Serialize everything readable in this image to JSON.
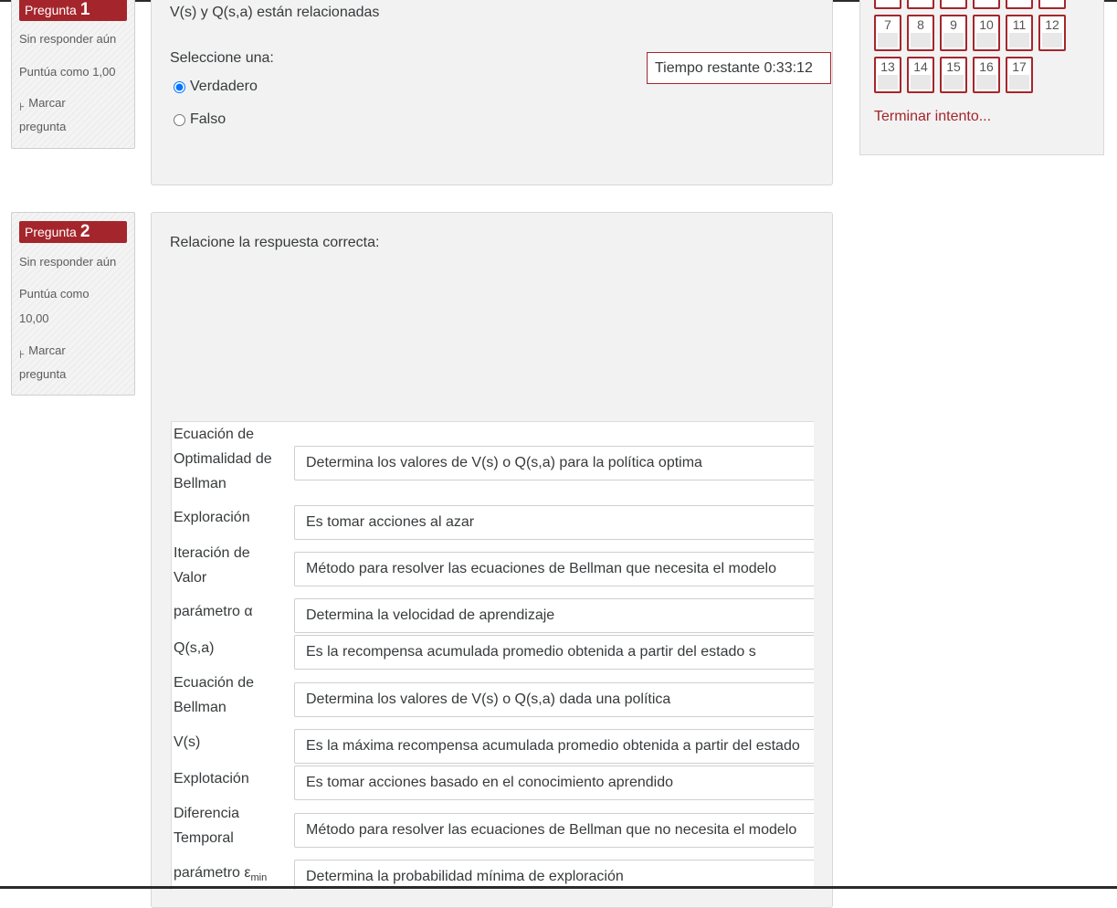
{
  "question1": {
    "badge_label": "Pregunta",
    "badge_number": "1",
    "state": "Sin responder aún",
    "grade": "Puntúa como 1,00",
    "flag_label_1": "Marcar",
    "flag_label_2": "pregunta",
    "flag_icon": "flag-icon",
    "text": "V(s) y Q(s,a) están relacionadas",
    "prompt": "Seleccione una:",
    "options": [
      {
        "label": "Verdadero",
        "checked": true
      },
      {
        "label": "Falso",
        "checked": false
      }
    ]
  },
  "timer": {
    "label": "Tiempo restante 0:33:12"
  },
  "nav": {
    "buttons_row1": [
      "7",
      "8",
      "9",
      "10",
      "11",
      "12"
    ],
    "buttons_row2": [
      "13",
      "14",
      "15",
      "16",
      "17"
    ],
    "finish_link": "Terminar intento..."
  },
  "question2": {
    "badge_label": "Pregunta",
    "badge_number": "2",
    "state": "Sin responder aún",
    "grade_1": "Puntúa como",
    "grade_2": "10,00",
    "flag_label_1": "Marcar",
    "flag_label_2": "pregunta",
    "flag_icon": "flag-icon",
    "text": "Relacione la respuesta correcta:",
    "rows": [
      {
        "term_lines": [
          "Ecuación de",
          "Optimalidad de",
          "Bellman"
        ],
        "answer": "Determina los valores de V(s) o Q(s,a) para la política optima"
      },
      {
        "term_lines": [
          "Exploración"
        ],
        "answer": "Es tomar acciones al azar"
      },
      {
        "term_lines": [
          "Iteración de",
          "Valor"
        ],
        "answer": "Método para resolver las ecuaciones de Bellman que necesita el modelo"
      },
      {
        "term_lines": [
          "parámetro α"
        ],
        "answer": "Determina la velocidad de aprendizaje"
      },
      {
        "term_lines": [
          "Q(s,a)"
        ],
        "answer": "Es la recompensa acumulada promedio obtenida a partir del estado s"
      },
      {
        "term_lines": [
          "Ecuación de",
          "Bellman"
        ],
        "answer": "Determina los valores de V(s) o Q(s,a) dada una política"
      },
      {
        "term_lines": [
          "V(s)"
        ],
        "answer": "Es la máxima recompensa acumulada promedio obtenida a partir del estado"
      },
      {
        "term_lines": [
          "Explotación"
        ],
        "answer": "Es tomar acciones basado en el conocimiento aprendido"
      },
      {
        "term_lines": [
          "Diferencia",
          "Temporal"
        ],
        "answer": "Método para resolver las ecuaciones de Bellman que no necesita el modelo"
      },
      {
        "term_lines": [
          "parámetro ε"
        ],
        "term_sub": "min",
        "answer": "Determina la probabilidad mínima de exploración"
      }
    ]
  },
  "colors": {
    "accent": "#a4262c",
    "panel_bg": "#f2f2f2"
  }
}
